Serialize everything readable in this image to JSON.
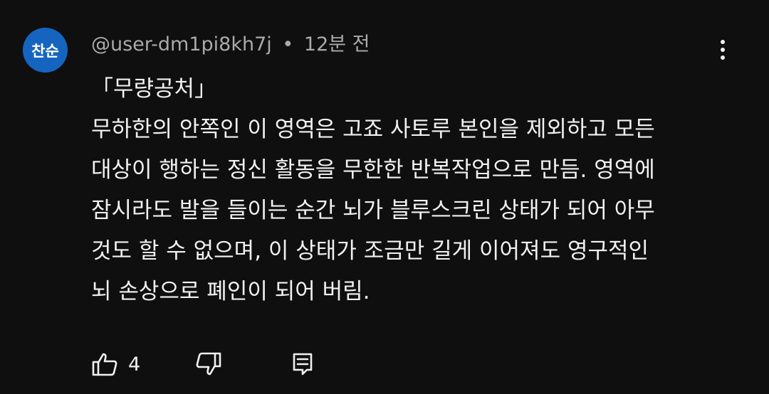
{
  "comment": {
    "avatar_text": "찬순",
    "author": "@user-dm1pi8kh7j",
    "separator": "•",
    "time": "12분 전",
    "lines": [
      "「무량공처」",
      "무하한의 안쪽인 이 영역은 고죠 사토루 본인을 제외하고 모든",
      "대상이 행하는 정신 활동을 무한한 반복작업으로 만듬. 영역에",
      "잠시라도 발을 들이는 순간 뇌가 블루스크린 상태가 되어 아무",
      "것도 할 수 없으며, 이 상태가 조금만 길게 이어져도 영구적인",
      "뇌 손상으로 폐인이 되어 버림."
    ],
    "like_count": "4"
  },
  "icons": {
    "menu": "more-vert-icon",
    "like": "thumb-up-icon",
    "dislike": "thumb-down-icon",
    "reply": "reply-comment-icon"
  },
  "colors": {
    "background": "#0f0f0f",
    "text": "#f1f1f1",
    "secondary_text": "#aaaaaa",
    "avatar": "#1565c0"
  }
}
